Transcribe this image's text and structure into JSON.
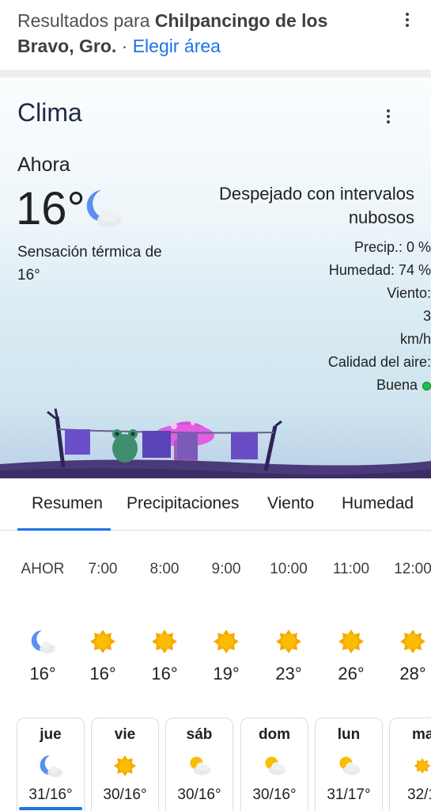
{
  "results": {
    "prefix": "Resultados para ",
    "location": "Chilpancingo de los Bravo, Gro.",
    "separator": " · ",
    "link": "Elegir área"
  },
  "card": {
    "title": "Clima",
    "now_label": "Ahora",
    "temperature": "16°",
    "feels_like": "Sensación térmica de 16°",
    "condition": "Despejado con intervalos nubosos",
    "condition_icon": "moon-cloud-icon",
    "stats": {
      "precip": "Precip.: 0 %",
      "humidity": "Humedad: 74 %",
      "wind_label": "Viento:",
      "wind_value": "3",
      "wind_unit": "km/h",
      "air_label": "Calidad del aire:",
      "air_value": "Buena"
    },
    "colors": {
      "air_good": "#1fc24a",
      "accent": "#1a73e8"
    }
  },
  "tabs": [
    {
      "label": "Resumen"
    },
    {
      "label": "Precipitaciones"
    },
    {
      "label": "Viento"
    },
    {
      "label": "Humedad"
    }
  ],
  "hourly": [
    {
      "time": "AHOR",
      "temp": "16°",
      "icon": "moon-cloud-icon"
    },
    {
      "time": "7:00",
      "temp": "16°",
      "icon": "sun-icon"
    },
    {
      "time": "8:00",
      "temp": "16°",
      "icon": "sun-icon"
    },
    {
      "time": "9:00",
      "temp": "19°",
      "icon": "sun-icon"
    },
    {
      "time": "10:00",
      "temp": "23°",
      "icon": "sun-icon"
    },
    {
      "time": "11:00",
      "temp": "26°",
      "icon": "sun-icon"
    },
    {
      "time": "12:00",
      "temp": "28°",
      "icon": "sun-icon"
    }
  ],
  "daily": [
    {
      "day": "jue",
      "temp": "31/16°",
      "icon": "moon-cloud-icon"
    },
    {
      "day": "vie",
      "temp": "30/16°",
      "icon": "sun-icon"
    },
    {
      "day": "sáb",
      "temp": "30/16°",
      "icon": "sun-cloud-icon"
    },
    {
      "day": "dom",
      "temp": "30/16°",
      "icon": "sun-cloud-icon"
    },
    {
      "day": "lun",
      "temp": "31/17°",
      "icon": "sun-cloud-icon"
    },
    {
      "day": "ma",
      "temp": "32/1",
      "icon": "sun-icon"
    }
  ]
}
